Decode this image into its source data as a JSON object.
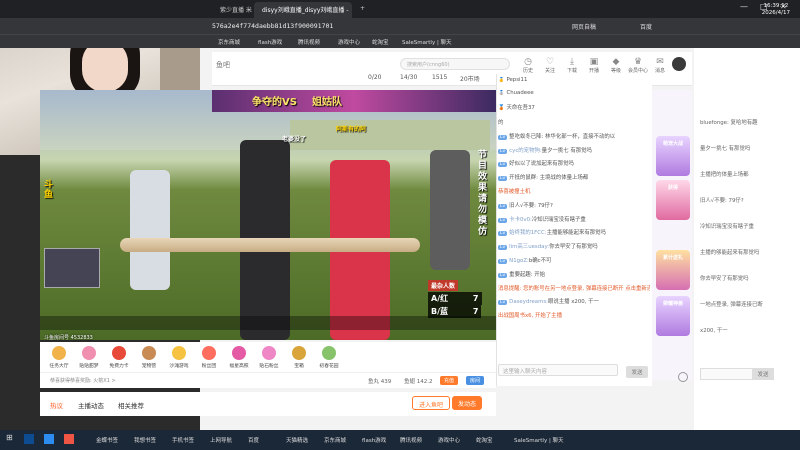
{
  "browser": {
    "tabs": [
      "紫少直播 米",
      "disyy刘峨直播_disyy刘峨直播 -"
    ],
    "new_tab": "+",
    "url": "576a2e4f774daebb81d13f900091701",
    "bookmarks": [
      "京东商城",
      "flash游戏",
      "腾讯视频",
      "游戏中心",
      "蛇淘宝",
      "SaleSmartly | 聊天"
    ],
    "toolbar": [
      "网页自稿",
      "百度"
    ],
    "window_controls": [
      "—",
      "□",
      "✕"
    ]
  },
  "site": {
    "logo": "鱼吧",
    "stats": [
      "0/20",
      "14/30",
      "1515",
      "20市场"
    ],
    "search_placeholder": "搜索用户(cnng60)",
    "nav_icons": [
      {
        "label": "历史",
        "icon": "history-icon"
      },
      {
        "label": "关注",
        "icon": "heart-icon"
      },
      {
        "label": "下载",
        "icon": "download-icon"
      },
      {
        "label": "开播",
        "icon": "camera-icon"
      },
      {
        "label": "等级",
        "icon": "level-icon"
      },
      {
        "label": "会员中心",
        "icon": "vip-icon"
      },
      {
        "label": "消息",
        "icon": "bell-icon"
      }
    ]
  },
  "video": {
    "banner_left": "争夺的VS",
    "banner_right": "姐姑队",
    "overlay_top": "老婆没了",
    "overlay_mid": "阿斯有的阿",
    "side_caption": "节目效果请勿模仿",
    "score_title": "最杂人数",
    "scores": [
      {
        "team": "A/红",
        "value": "7"
      },
      {
        "team": "B/蓝",
        "value": "7"
      }
    ],
    "watermark": "斗鱼房间号 4532833",
    "left_caption": "斗鱼"
  },
  "gifts": [
    "任务大厅",
    "贴贴甜梦",
    "免费力卡",
    "宠物营",
    "沙滩游戏",
    "粉丝团",
    "福星高照",
    "贴石粉丝",
    "宝箱",
    "初春花园"
  ],
  "info": {
    "follow_text": "恭喜获得恭喜奖励: 火箭X1 >",
    "fish_balls": "鱼丸 439",
    "fans": "鱼翅 142.2",
    "btn_open": "充值",
    "btn_room": "房间"
  },
  "page_tabs": [
    "热议",
    "主播动态",
    "相关推荐"
  ],
  "follow_buttons": [
    "进入鱼吧",
    "发动态"
  ],
  "chat": {
    "top_users": [
      "Pepsi11",
      "Chuadeee",
      "天命在吾37"
    ],
    "messages": [
      {
        "level": "",
        "name": "",
        "text": "的",
        "highlight": false
      },
      {
        "level": "Lv",
        "name": "",
        "text": "整吃蚁冬已降: 林华化部一杯，直接不动的以",
        "highlight": false
      },
      {
        "level": "Lv",
        "name": "cyc的宠物狗:",
        "text": "量夕一挑七 有那觉吗",
        "highlight": false
      },
      {
        "level": "Lv",
        "name": "",
        "text": "好似以了说加起来有那觉吗",
        "highlight": false
      },
      {
        "level": "Lv",
        "name": "",
        "text": "开抵的鼠群: 主境战的体量上场都",
        "highlight": false
      },
      {
        "level": "",
        "name": "",
        "text": "恭喜被撞土机",
        "highlight": true
      },
      {
        "level": "Lv",
        "name": "",
        "text": "旧人√不要: 79仔?",
        "highlight": false
      },
      {
        "level": "Lv",
        "name": "卡卡0v0:",
        "text": "冷知识瑞宝没有瞎子重",
        "highlight": false
      },
      {
        "level": "Lv",
        "name": "始终我的1FCC:",
        "text": "主播能够能起来有那觉吗",
        "highlight": false
      },
      {
        "level": "Lv",
        "name": "lim高三uesday:",
        "text": "你去早安了有那觉吗",
        "highlight": false
      },
      {
        "level": "Lv",
        "name": "N1goZ:",
        "text": "b确c不可",
        "highlight": false
      },
      {
        "level": "Lv",
        "name": "",
        "text": "重要起趣: 开始",
        "highlight": false
      },
      {
        "level": "",
        "name": "",
        "text": "消息提醒: 您的账号在另一地点登录, 弹幕连接已断开 点击重新连接弹幕",
        "highlight": true
      },
      {
        "level": "Lv",
        "name": "Daseydreams:",
        "text": "眼说主播 x200, 干一",
        "highlight": false
      },
      {
        "level": "",
        "name": "",
        "text": "出战国周书x6, 开始了主播",
        "highlight": true
      }
    ],
    "input_placeholder": "这里输入聊天内容",
    "send": "发送"
  },
  "promos": [
    "萌宠大战",
    "获得",
    "累计送礼",
    "荣耀神兽"
  ],
  "second_chat": [
    "bluefonge: 复哈地有趣",
    "量夕一挑七 有那觉吗",
    "主播把的体量上场都",
    "旧人√不要: 79仔?",
    "冷知识瑞宝没有瞎子重",
    "主播的够能起来有那觉吗",
    "你去早安了有那觉吗",
    "一地点登录, 弹幕连接已断",
    "x200, 干一"
  ],
  "taskbar": {
    "items": [
      "金蝶书签",
      "我想书签",
      "手机书签",
      "上网导航",
      "百度",
      "天猫精选",
      "京东商城",
      "flash游戏",
      "腾讯视频",
      "游戏中心",
      "蛇淘宝",
      "SaleSmartly | 聊天"
    ],
    "time": "16:39:12",
    "date": "2026/4/17"
  }
}
